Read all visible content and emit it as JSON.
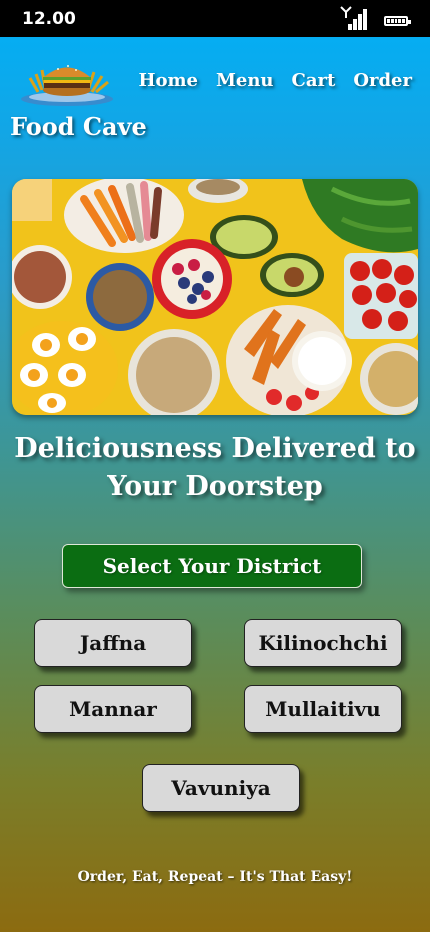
{
  "status": {
    "time": "12.00"
  },
  "brand": {
    "name": "Food Cave"
  },
  "nav": {
    "items": [
      "Home",
      "Menu",
      "Cart",
      "Order"
    ]
  },
  "hero": {
    "image": "healthy-food-spread"
  },
  "headline": {
    "line1": "Deliciousness Delivered to",
    "line2": "Your Doorstep"
  },
  "cta": {
    "select_label": "Select Your District",
    "color": "#0b6d12"
  },
  "districts": [
    "Jaffna",
    "Kilinochchi",
    "Mannar",
    "Mullaitivu",
    "Vavuniya"
  ],
  "footer": {
    "tagline": "Order, Eat, Repeat – It's That Easy!"
  }
}
